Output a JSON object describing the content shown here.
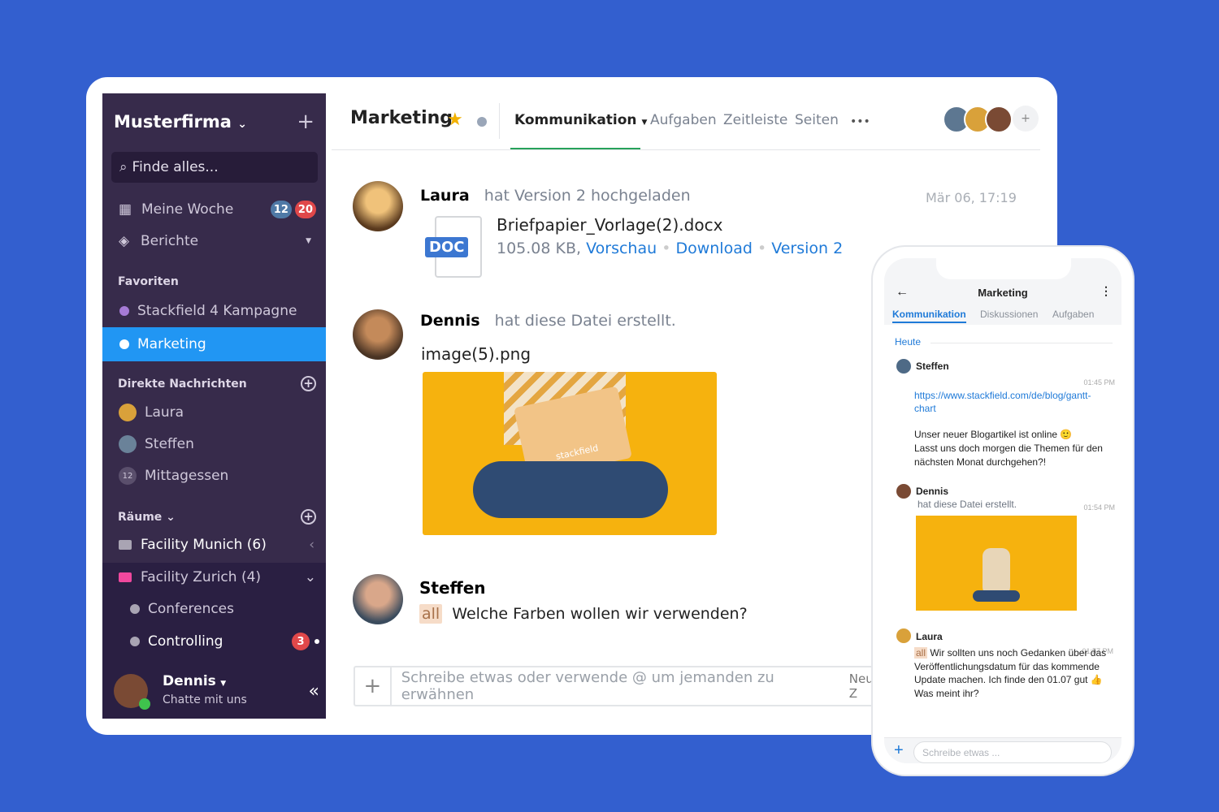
{
  "colors": {
    "background": "#335fcf",
    "sidebar": "#372b4b",
    "active": "#2196f3",
    "accent_green": "#27a25a",
    "link": "#1f7ad8",
    "badge_blue": "#4f79a6",
    "badge_red": "#e0484a"
  },
  "sidebar": {
    "company": "Musterfirma",
    "search_placeholder": "Finde alles...",
    "nav": [
      {
        "label": "Meine Woche",
        "icon": "calendar-icon",
        "badges": [
          "12",
          "20"
        ]
      },
      {
        "label": "Berichte",
        "icon": "layers-icon"
      }
    ],
    "favorites_title": "Favoriten",
    "favorites": [
      {
        "label": "Stackfield 4 Kampagne",
        "color": "#a67bd6"
      },
      {
        "label": "Marketing",
        "color": "#ffffff",
        "active": true
      }
    ],
    "dm_title": "Direkte Nachrichten",
    "dms": [
      {
        "label": "Laura"
      },
      {
        "label": "Steffen"
      },
      {
        "label": "Mittagessen",
        "count": "12"
      }
    ],
    "rooms_title": "Räume",
    "rooms": [
      {
        "label": "Facility Munich (6)",
        "color": "#a9a4b3"
      },
      {
        "label": "Facility Zurich (4)",
        "color": "#f0489e"
      }
    ],
    "subrooms": [
      {
        "label": "Conferences"
      },
      {
        "label": "Controlling",
        "badge": "3"
      }
    ],
    "user": {
      "name": "Dennis",
      "status": "Chatte mit uns"
    }
  },
  "header": {
    "title": "Marketing",
    "tabs": [
      "Kommunikation",
      "Aufgaben",
      "Zeitleiste",
      "Seiten"
    ],
    "active_tab": "Kommunikation",
    "more": "•••",
    "add_member": "+"
  },
  "feed": [
    {
      "author": "Laura",
      "action": "hat Version 2 hochgeladen",
      "time": "Mär 06, 17:19",
      "file": {
        "type": "DOC",
        "name": "Briefpapier_Vorlage(2).docx",
        "size": "105.08 KB,",
        "links": [
          "Vorschau",
          "Download",
          "Version 2"
        ]
      }
    },
    {
      "author": "Dennis",
      "action": "hat diese Datei erstellt.",
      "file": {
        "name": "image(5).png"
      },
      "image_text": "stackfield"
    },
    {
      "author": "Steffen",
      "mention": "all",
      "text": "Welche Farben wollen wir verwenden?"
    }
  ],
  "composer": {
    "placeholder": "Schreibe etwas oder verwende @ um jemanden zu erwähnen",
    "right": "Neue Z",
    "plus": "+"
  },
  "phone": {
    "title": "Marketing",
    "tabs": [
      "Kommunikation",
      "Diskussionen",
      "Aufgaben"
    ],
    "day": "Heute",
    "messages": [
      {
        "author": "Steffen",
        "time": "01:45 PM",
        "link": "https://www.stackfield.com/de/blog/gantt-chart",
        "text1": "Unser neuer Blogartikel ist online 🙂",
        "text2": "Lasst uns doch morgen die Themen für den nächsten Monat durchgehen?!"
      },
      {
        "author": "Dennis",
        "action": "hat diese Datei erstellt.",
        "time": "01:54 PM"
      },
      {
        "author": "Laura",
        "mention": "all",
        "time": "01:57 PM",
        "text": "Wir sollten uns noch Gedanken über das Veröffentlichungsdatum für das kommende Update machen. Ich finde den 01.07 gut 👍 Was meint ihr?"
      }
    ],
    "input_placeholder": "Schreibe etwas ..."
  }
}
